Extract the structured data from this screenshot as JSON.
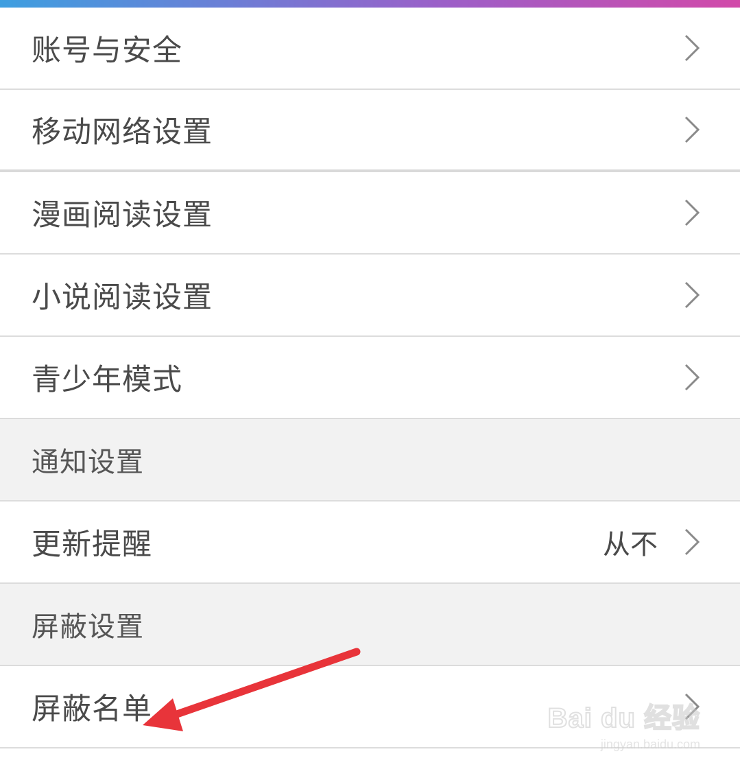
{
  "settings": {
    "items": [
      {
        "label": "账号与安全"
      },
      {
        "label": "移动网络设置"
      },
      {
        "label": "漫画阅读设置"
      },
      {
        "label": "小说阅读设置"
      },
      {
        "label": "青少年模式"
      }
    ],
    "notify_section": {
      "label": "通知设置"
    },
    "update_reminder": {
      "label": "更新提醒",
      "value": "从不"
    },
    "block_section": {
      "label": "屏蔽设置"
    },
    "block_list": {
      "label": "屏蔽名单"
    }
  },
  "watermark": {
    "logo_text": "Bai du 经验",
    "url": "jingyan.baidu.com"
  },
  "colors": {
    "annotation_arrow": "#e8343a",
    "gradient_start": "#3e9fe0",
    "gradient_end": "#d24aa9"
  },
  "icons": {
    "row_chevron": "chevron-right-icon"
  }
}
